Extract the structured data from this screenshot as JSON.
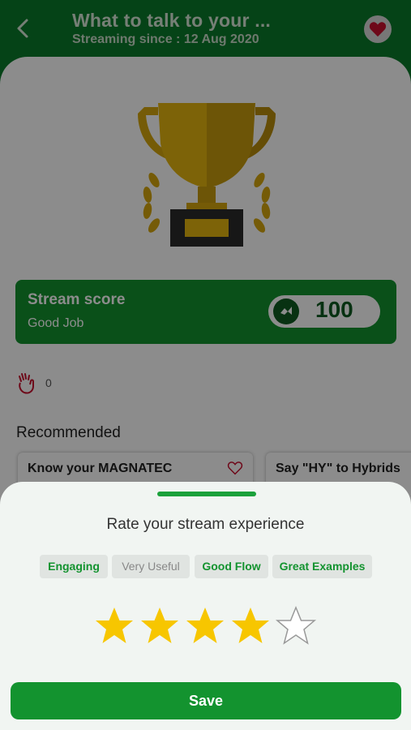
{
  "header": {
    "title": "What to talk to your ...",
    "subtitle": "Streaming since : 12 Aug 2020",
    "back_icon": "back-arrow-icon",
    "favorite_icon": "heart-icon",
    "favorite_color": "#c8102e"
  },
  "score": {
    "title": "Stream score",
    "subtitle": "Good Job",
    "value": "100",
    "icon": "score-badge-icon"
  },
  "claps": {
    "icon": "clap-icon",
    "count": "0"
  },
  "recommended": {
    "title": "Recommended",
    "cards": [
      {
        "label": "Know your MAGNATEC"
      },
      {
        "label": "Say \"HY\" to Hybrids"
      }
    ]
  },
  "rating_sheet": {
    "title": "Rate your stream experience",
    "chips": [
      {
        "label": "Engaging",
        "selected": true
      },
      {
        "label": "Very Useful",
        "selected": false
      },
      {
        "label": "Good Flow",
        "selected": true
      },
      {
        "label": "Great Examples",
        "selected": true
      }
    ],
    "rating": 4,
    "max_rating": 5,
    "save_label": "Save"
  },
  "colors": {
    "brand_green": "#13932f",
    "header_green": "#0a7a2b",
    "star_yellow": "#f7c600"
  }
}
